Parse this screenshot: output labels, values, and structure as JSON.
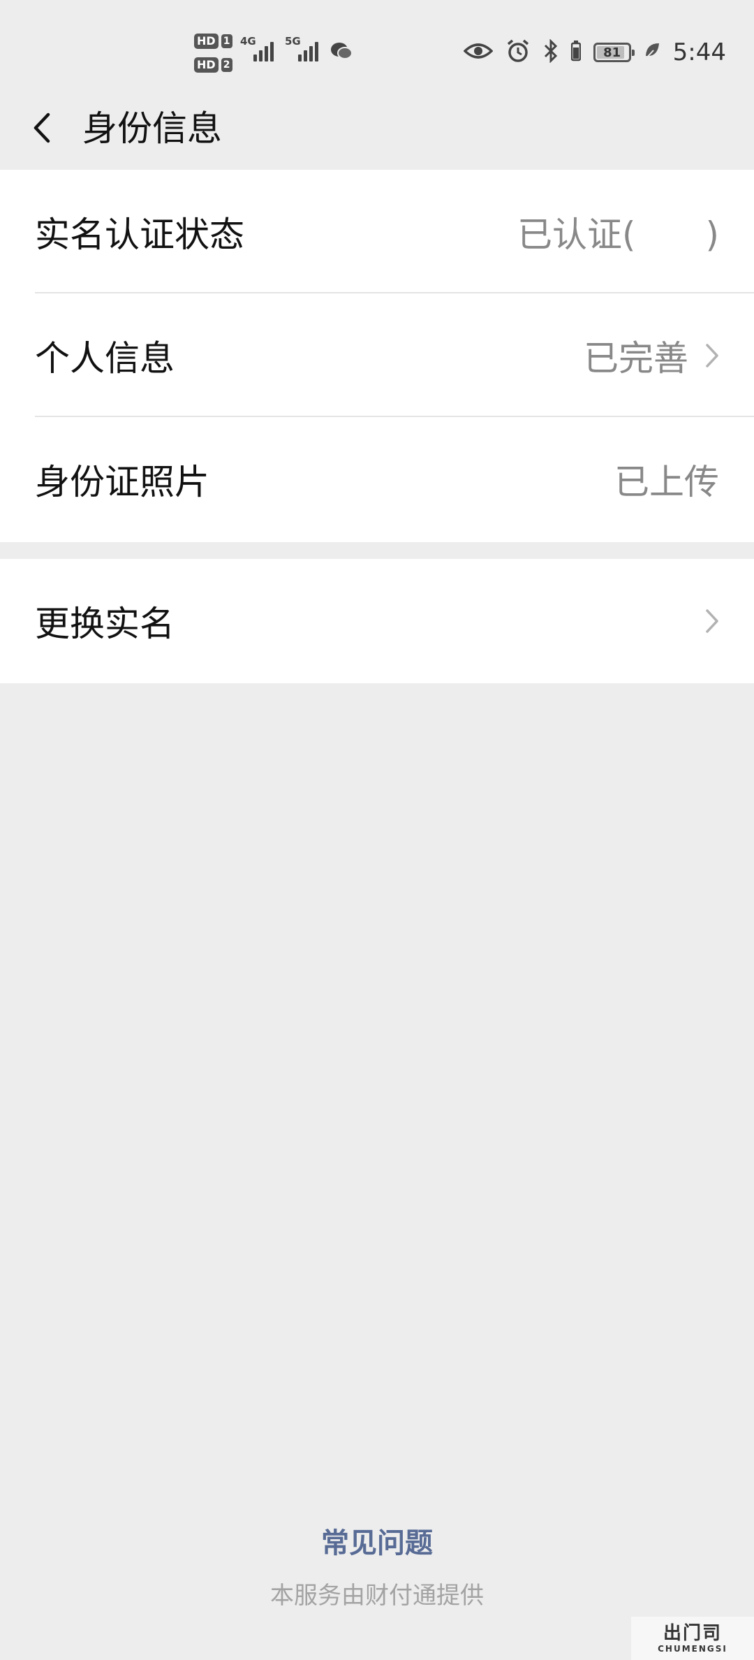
{
  "status_bar": {
    "sim1_label": "HD",
    "sim1_num": "1",
    "sim2_label": "HD",
    "sim2_num": "2",
    "net1": "4G",
    "net2": "5G",
    "battery_level": "81",
    "time": "5:44",
    "icons": [
      "eye-icon",
      "alarm-icon",
      "bluetooth-icon",
      "battery-icon",
      "leaf-icon",
      "wechat-notification-icon"
    ]
  },
  "nav": {
    "title": "身份信息",
    "back_icon": "chevron-left-icon"
  },
  "sections": {
    "verification": {
      "rows": [
        {
          "label": "实名认证状态",
          "value": "已认证(　　)",
          "has_chevron": false
        },
        {
          "label": "个人信息",
          "value": "已完善",
          "has_chevron": true
        },
        {
          "label": "身份证照片",
          "value": "已上传",
          "has_chevron": false
        }
      ]
    },
    "change": {
      "rows": [
        {
          "label": "更换实名",
          "value": "",
          "has_chevron": true
        }
      ]
    }
  },
  "footer": {
    "faq_label": "常见问题",
    "provider_text": "本服务由财付通提供"
  },
  "colors": {
    "background": "#ededed",
    "card": "#ffffff",
    "value_text": "#888888",
    "link": "#576b95",
    "footer_text": "#a3a3a3"
  },
  "watermark": {
    "top": "出门司",
    "bottom": "CHUMENGSI"
  }
}
